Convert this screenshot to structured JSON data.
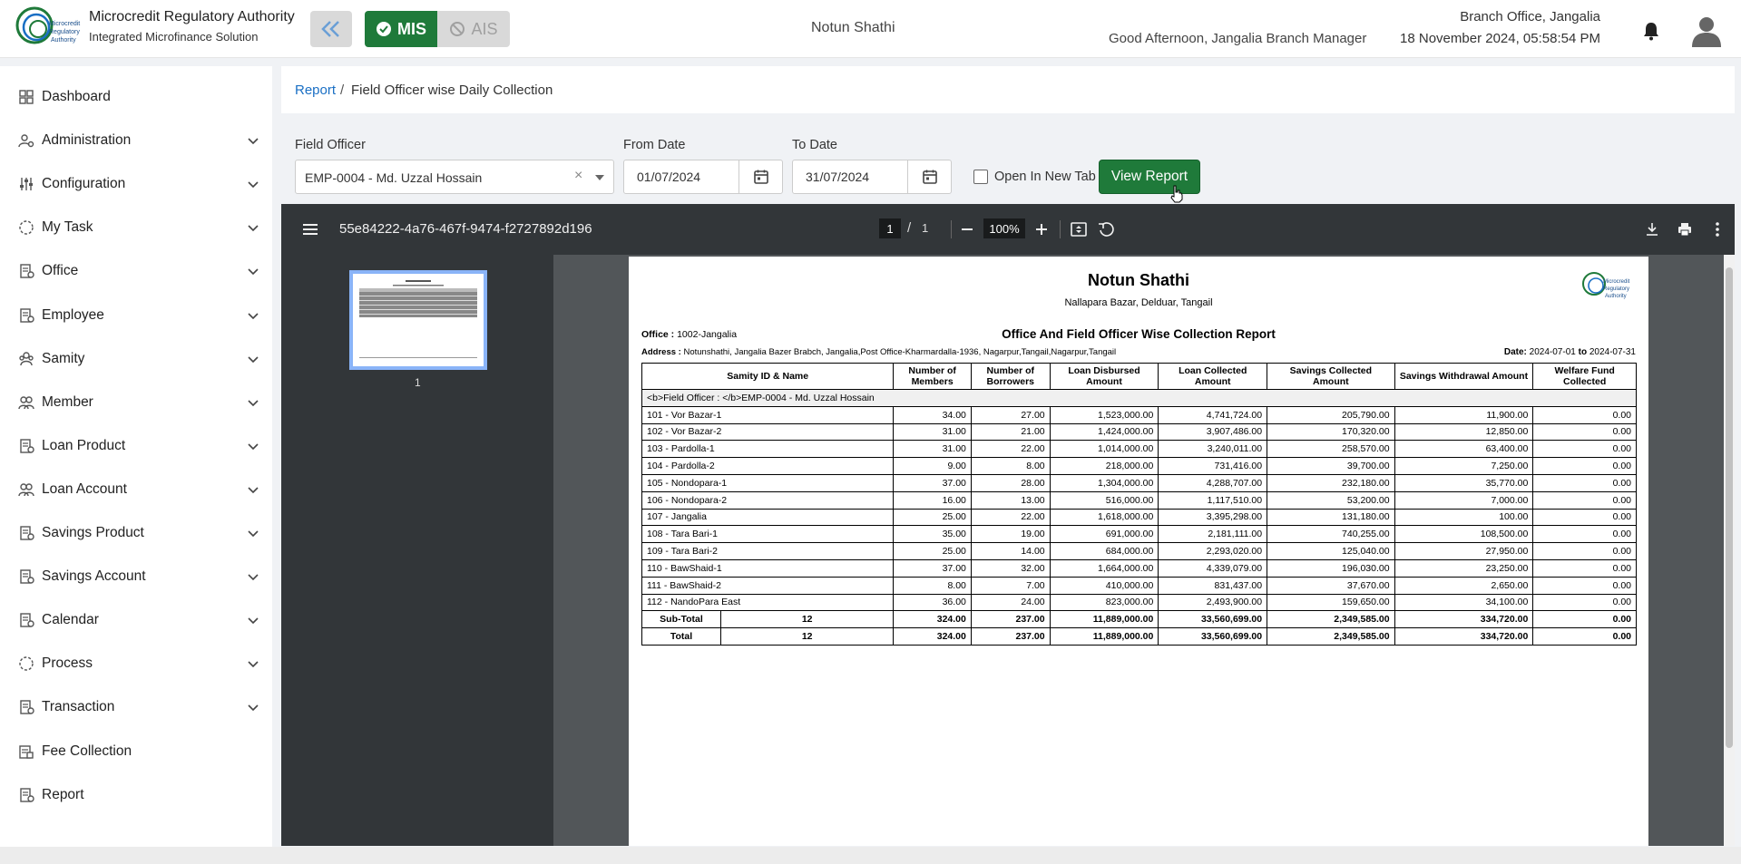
{
  "header": {
    "brand_title": "Microcredit Regulatory Authority",
    "brand_subtitle": "Integrated Microfinance Solution",
    "logo_text": "Microcredit Regulatory Authority",
    "mode_mis": "MIS",
    "mode_ais": "AIS",
    "organization": "Notun Shathi",
    "greeting": "Good Afternoon, Jangalia Branch Manager",
    "branch": "Branch Office, Jangalia",
    "datetime": "18 November 2024, 05:58:54 PM"
  },
  "sidebar": {
    "items": [
      {
        "label": "Dashboard",
        "icon": "dashboard-icon",
        "expandable": false
      },
      {
        "label": "Administration",
        "icon": "admin-icon",
        "expandable": true
      },
      {
        "label": "Configuration",
        "icon": "sliders-icon",
        "expandable": true
      },
      {
        "label": "My Task",
        "icon": "task-icon",
        "expandable": true
      },
      {
        "label": "Office",
        "icon": "office-icon",
        "expandable": true
      },
      {
        "label": "Employee",
        "icon": "employee-icon",
        "expandable": true
      },
      {
        "label": "Samity",
        "icon": "samity-icon",
        "expandable": true
      },
      {
        "label": "Member",
        "icon": "member-icon",
        "expandable": true
      },
      {
        "label": "Loan Product",
        "icon": "loan-product-icon",
        "expandable": true
      },
      {
        "label": "Loan Account",
        "icon": "loan-account-icon",
        "expandable": true
      },
      {
        "label": "Savings Product",
        "icon": "savings-product-icon",
        "expandable": true
      },
      {
        "label": "Savings Account",
        "icon": "savings-account-icon",
        "expandable": true
      },
      {
        "label": "Calendar",
        "icon": "calendar-icon",
        "expandable": true
      },
      {
        "label": "Process",
        "icon": "process-icon",
        "expandable": true
      },
      {
        "label": "Transaction",
        "icon": "transaction-icon",
        "expandable": true
      },
      {
        "label": "Fee Collection",
        "icon": "fee-icon",
        "expandable": false
      },
      {
        "label": "Report",
        "icon": "report-icon",
        "expandable": false
      }
    ]
  },
  "breadcrumb": {
    "parent": "Report",
    "separator": "/",
    "current": "Field Officer wise Daily Collection"
  },
  "filters": {
    "field_officer_label": "Field Officer",
    "field_officer_value": "EMP-0004 - Md. Uzzal Hossain",
    "from_date_label": "From Date",
    "from_date_value": "01/07/2024",
    "to_date_label": "To Date",
    "to_date_value": "31/07/2024",
    "open_new_tab_label": "Open In New Tab",
    "open_new_tab_checked": false,
    "view_report_label": "View Report"
  },
  "pdf_viewer": {
    "file_title": "55e84222-4a76-467f-9474-f2727892d196",
    "current_page": "1",
    "page_separator": "/",
    "total_pages": "1",
    "zoom": "100%",
    "thumbnail_label": "1"
  },
  "report": {
    "org_name": "Notun Shathi",
    "org_address": "Nallapara Bazar, Delduar, Tangail",
    "office_label": "Office :",
    "office_value": "1002-Jangalia",
    "title": "Office And Field Officer Wise Collection Report",
    "address_label": "Address :",
    "address_value": "Notunshathi, Jangalia Bazer Brabch, Jangalia,Post Office-Kharmardalla-1936, Nagarpur,Tangail,Nagarpur,Tangail",
    "date_label": "Date:",
    "date_from": "2024-07-01",
    "date_to_word": "to",
    "date_to": "2024-07-31",
    "columns": [
      "Samity ID & Name",
      "Number of Members",
      "Number of Borrowers",
      "Loan Disbursed Amount",
      "Loan Collected Amount",
      "Savings Collected Amount",
      "Savings Withdrawal Amount",
      "Welfare Fund Collected"
    ],
    "field_officer_row": "<b>Field Officer : </b>EMP-0004 - Md. Uzzal Hossain",
    "rows": [
      [
        "101 - Vor Bazar-1",
        "34.00",
        "27.00",
        "1,523,000.00",
        "4,741,724.00",
        "205,790.00",
        "11,900.00",
        "0.00"
      ],
      [
        "102 - Vor Bazar-2",
        "31.00",
        "21.00",
        "1,424,000.00",
        "3,907,486.00",
        "170,320.00",
        "12,850.00",
        "0.00"
      ],
      [
        "103 - Pardolla-1",
        "31.00",
        "22.00",
        "1,014,000.00",
        "3,240,011.00",
        "258,570.00",
        "63,400.00",
        "0.00"
      ],
      [
        "104 - Pardolla-2",
        "9.00",
        "8.00",
        "218,000.00",
        "731,416.00",
        "39,700.00",
        "7,250.00",
        "0.00"
      ],
      [
        "105 - Nondopara-1",
        "37.00",
        "28.00",
        "1,304,000.00",
        "4,288,707.00",
        "232,180.00",
        "35,770.00",
        "0.00"
      ],
      [
        "106 - Nondopara-2",
        "16.00",
        "13.00",
        "516,000.00",
        "1,117,510.00",
        "53,200.00",
        "7,000.00",
        "0.00"
      ],
      [
        "107 - Jangalia",
        "25.00",
        "22.00",
        "1,618,000.00",
        "3,395,298.00",
        "131,180.00",
        "100.00",
        "0.00"
      ],
      [
        "108 - Tara Bari-1",
        "35.00",
        "19.00",
        "691,000.00",
        "2,181,111.00",
        "740,255.00",
        "108,500.00",
        "0.00"
      ],
      [
        "109 - Tara Bari-2",
        "25.00",
        "14.00",
        "684,000.00",
        "2,293,020.00",
        "125,040.00",
        "27,950.00",
        "0.00"
      ],
      [
        "110 - BawShaid-1",
        "37.00",
        "32.00",
        "1,664,000.00",
        "4,339,079.00",
        "196,030.00",
        "23,250.00",
        "0.00"
      ],
      [
        "111 - BawShaid-2",
        "8.00",
        "7.00",
        "410,000.00",
        "831,437.00",
        "37,670.00",
        "2,650.00",
        "0.00"
      ],
      [
        "112 - NandoPara East",
        "36.00",
        "24.00",
        "823,000.00",
        "2,493,900.00",
        "159,650.00",
        "34,100.00",
        "0.00"
      ]
    ],
    "subtotal": [
      "Sub-Total",
      "12",
      "324.00",
      "237.00",
      "11,889,000.00",
      "33,560,699.00",
      "2,349,585.00",
      "334,720.00",
      "0.00"
    ],
    "total": [
      "Total",
      "12",
      "324.00",
      "237.00",
      "11,889,000.00",
      "33,560,699.00",
      "2,349,585.00",
      "334,720.00",
      "0.00"
    ]
  }
}
